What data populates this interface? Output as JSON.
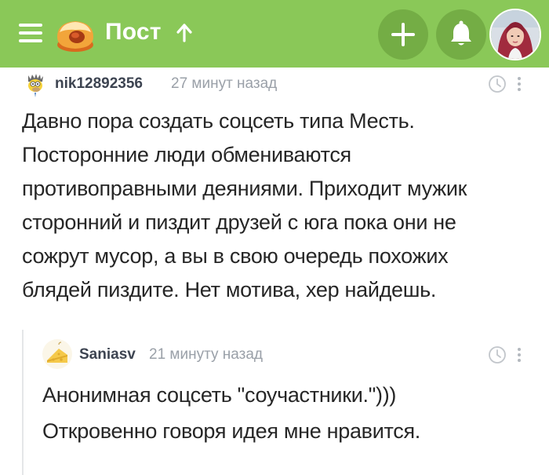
{
  "header": {
    "title": "Пост",
    "icons": {
      "menu": "menu-icon",
      "logo": "pikabu-logo",
      "scroll_up": "arrow-up-icon",
      "add": "plus-icon",
      "notifications": "bell-icon",
      "profile": "avatar"
    },
    "colors": {
      "bar": "#8ac858",
      "button": "#74ad45"
    }
  },
  "comments": [
    {
      "username": "nik12892356",
      "time": "27 минут назад",
      "lines": [
        "Давно пора создать соцсеть типа Месть.",
        "Посторонние люди обмениваются",
        "противоправными деяниями. Приходит мужик",
        "сторонний и пиздит друзей с юга пока они не",
        "сожрут мусор, а вы в свою очередь похожих",
        "блядей пиздите. Нет мотива, хер найдешь."
      ]
    },
    {
      "username": "Saniasv",
      "time": "21 минуту назад",
      "lines": [
        "Анонимная соцсеть \"соучастники.\")))",
        "Откровенно говоря идея мне нравится."
      ]
    }
  ]
}
